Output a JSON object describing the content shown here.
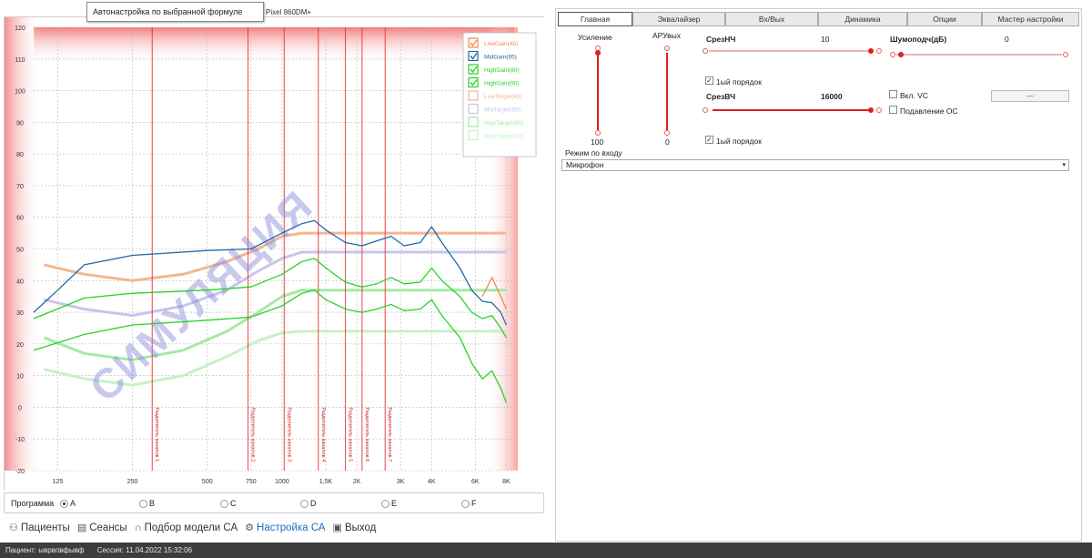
{
  "tooltip": {
    "text": "Автонастройка по выбранной формуле"
  },
  "device": {
    "model": "Pixel 860DM+"
  },
  "watermark": "СИМУЛЯЦИЯ",
  "chart_data": {
    "type": "line",
    "x_ticks": [
      "125",
      "250",
      "500",
      "750",
      "1000",
      "1,5K",
      "2K",
      "3K",
      "4K",
      "6K",
      "8K"
    ],
    "x_tick_hz": [
      125,
      250,
      500,
      750,
      1000,
      1500,
      2000,
      3000,
      4000,
      6000,
      8000
    ],
    "ylim": [
      -20,
      120
    ],
    "y_ticks": [
      -20,
      -10,
      0,
      10,
      20,
      30,
      40,
      50,
      60,
      70,
      80,
      90,
      100,
      110,
      120
    ],
    "series": [
      {
        "name": "LowGain(45)",
        "color": "#f08a50",
        "checked": true,
        "points": [
          [
            8000,
            31
          ],
          [
            7600,
            35
          ],
          [
            7000,
            41
          ],
          [
            6400,
            35
          ]
        ]
      },
      {
        "name": "MidGain(65)",
        "color": "#1f6aa8",
        "checked": true,
        "points": [
          [
            100,
            30
          ],
          [
            125,
            37
          ],
          [
            160,
            45
          ],
          [
            250,
            48
          ],
          [
            500,
            49.5
          ],
          [
            750,
            50
          ],
          [
            1000,
            55
          ],
          [
            1200,
            58
          ],
          [
            1350,
            59
          ],
          [
            1500,
            56
          ],
          [
            1800,
            52
          ],
          [
            2100,
            51
          ],
          [
            2400,
            52.5
          ],
          [
            2750,
            54
          ],
          [
            3100,
            51
          ],
          [
            3600,
            52
          ],
          [
            4000,
            57
          ],
          [
            4400,
            52
          ],
          [
            5200,
            44
          ],
          [
            5800,
            37
          ],
          [
            6400,
            33.5
          ],
          [
            7000,
            33
          ],
          [
            7600,
            30
          ],
          [
            8000,
            26
          ]
        ]
      },
      {
        "name": "HighGain(80)",
        "color": "#28d228",
        "checked": true,
        "points": [
          [
            100,
            28
          ],
          [
            160,
            34.5
          ],
          [
            250,
            36
          ],
          [
            500,
            37
          ],
          [
            750,
            38
          ],
          [
            1000,
            42
          ],
          [
            1200,
            46
          ],
          [
            1350,
            47
          ],
          [
            1500,
            44
          ],
          [
            1800,
            39.5
          ],
          [
            2100,
            38
          ],
          [
            2400,
            39
          ],
          [
            2750,
            41
          ],
          [
            3100,
            39
          ],
          [
            3600,
            39.5
          ],
          [
            4000,
            44
          ],
          [
            4400,
            40
          ],
          [
            5200,
            35
          ],
          [
            5800,
            30
          ],
          [
            6400,
            28
          ],
          [
            7000,
            29
          ],
          [
            7600,
            25
          ],
          [
            8000,
            22
          ]
        ]
      },
      {
        "name": "HighGain(90)",
        "color": "#28d228",
        "checked": true,
        "points": [
          [
            100,
            18
          ],
          [
            160,
            23
          ],
          [
            250,
            26
          ],
          [
            500,
            27.5
          ],
          [
            750,
            28.5
          ],
          [
            1000,
            32
          ],
          [
            1200,
            36
          ],
          [
            1350,
            37
          ],
          [
            1500,
            34
          ],
          [
            1800,
            31
          ],
          [
            2100,
            30
          ],
          [
            2400,
            31
          ],
          [
            2750,
            32.5
          ],
          [
            3100,
            30.5
          ],
          [
            3600,
            31
          ],
          [
            4000,
            34
          ],
          [
            4400,
            29
          ],
          [
            5200,
            22
          ],
          [
            5800,
            14
          ],
          [
            6400,
            9
          ],
          [
            7000,
            11.5
          ],
          [
            7600,
            6
          ],
          [
            8000,
            1.5
          ]
        ]
      },
      {
        "name": "LowTarget(45)",
        "color": "#f5b592",
        "checked": false,
        "points": [
          [
            110,
            45
          ],
          [
            160,
            42
          ],
          [
            250,
            40
          ],
          [
            400,
            42
          ],
          [
            600,
            46
          ],
          [
            800,
            50
          ],
          [
            1000,
            54
          ],
          [
            1200,
            55
          ],
          [
            1500,
            55
          ],
          [
            8000,
            55
          ]
        ]
      },
      {
        "name": "MidTarget(65)",
        "color": "#c8c4ec",
        "checked": false,
        "points": [
          [
            110,
            34
          ],
          [
            160,
            31
          ],
          [
            250,
            29
          ],
          [
            400,
            32
          ],
          [
            600,
            37
          ],
          [
            800,
            43
          ],
          [
            1000,
            47
          ],
          [
            1200,
            49
          ],
          [
            1500,
            49
          ],
          [
            8000,
            49
          ]
        ]
      },
      {
        "name": "HighTarget(80)",
        "color": "#a4eaa4",
        "checked": false,
        "points": [
          [
            110,
            22
          ],
          [
            160,
            17
          ],
          [
            250,
            15
          ],
          [
            400,
            18
          ],
          [
            600,
            24
          ],
          [
            800,
            30
          ],
          [
            1000,
            35
          ],
          [
            1200,
            37
          ],
          [
            1500,
            37
          ],
          [
            8000,
            37
          ]
        ]
      },
      {
        "name": "HighTarget(90)",
        "color": "#c6f2c6",
        "checked": false,
        "points": [
          [
            110,
            12
          ],
          [
            160,
            9
          ],
          [
            250,
            7
          ],
          [
            400,
            10
          ],
          [
            600,
            16
          ],
          [
            800,
            21
          ],
          [
            1000,
            23.5
          ],
          [
            1200,
            24
          ],
          [
            1500,
            24
          ],
          [
            8000,
            24
          ]
        ]
      }
    ],
    "markers": [
      {
        "hz": 300,
        "label": "Разделитель каналов 1"
      },
      {
        "hz": 730,
        "label": "Разделитель каналов 2"
      },
      {
        "hz": 1020,
        "label": "Разделитель каналов 3"
      },
      {
        "hz": 1400,
        "label": "Разделитель каналов 4"
      },
      {
        "hz": 1800,
        "label": "Разделитель каналов 5"
      },
      {
        "hz": 2100,
        "label": "Разделитель каналов 6"
      },
      {
        "hz": 2600,
        "label": "Разделитель каналов 7"
      }
    ]
  },
  "program": {
    "label": "Программа",
    "selected": "A",
    "options": [
      "A",
      "B",
      "C",
      "D",
      "E",
      "F"
    ]
  },
  "nav": {
    "items": [
      {
        "label": "Пациенты",
        "icon": "patients-icon",
        "glyph": "⚇"
      },
      {
        "label": "Сеансы",
        "icon": "sessions-icon",
        "glyph": "▤"
      },
      {
        "label": "Подбор модели СА",
        "icon": "headphones-icon",
        "glyph": "∩"
      },
      {
        "label": "Настройка СА",
        "icon": "settings-icon",
        "glyph": "⚙"
      },
      {
        "label": "Выход",
        "icon": "exit-icon",
        "glyph": "▣"
      }
    ],
    "active": "Настройка СА"
  },
  "status": {
    "patient": "Пациент: ыврвпвфывф",
    "session": "Сессия: 11.04.2022 15:32:06"
  },
  "right": {
    "tabs": [
      "Главная",
      "Эквалайзер",
      "Вх/Вых",
      "Динамика",
      "Опции",
      "Мастер настройки"
    ],
    "active_tab": "Главная",
    "gain": {
      "label": "Усиление",
      "value": "100"
    },
    "arum": {
      "label": "АРУвых",
      "value": "0"
    },
    "lowcut": {
      "label": "СрезНЧ",
      "value": "10"
    },
    "noise": {
      "label": "Шумоподч(дБ)",
      "value": "0"
    },
    "order1": {
      "label": "1ый порядок",
      "checked": true
    },
    "highcut": {
      "label": "СрезВЧ",
      "value": "16000"
    },
    "vc": {
      "label": "Вкл. VC",
      "checked": false
    },
    "feedback": {
      "label": "Подавление ОС",
      "checked": false
    },
    "button_label": "—",
    "order2": {
      "label": "1ый порядок",
      "checked": true
    },
    "input_mode": {
      "label": "Режим по входу",
      "value": "Микрофон"
    }
  }
}
